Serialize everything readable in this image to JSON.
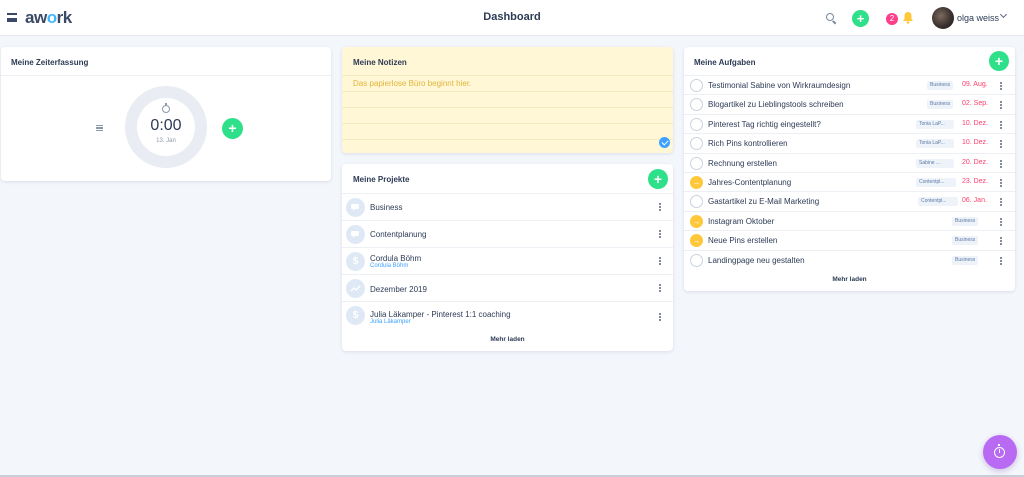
{
  "header": {
    "logo_prefix": "aw",
    "logo_o": "o",
    "logo_suffix": "rk",
    "title": "Dashboard",
    "add_label": "+",
    "notification_count": "2",
    "user_name": "olga weiss"
  },
  "time_tracking": {
    "title": "Meine Zeiterfassung",
    "time": "0:00",
    "date": "13. Jan",
    "add_label": "+"
  },
  "notes": {
    "title": "Meine Notizen",
    "text": "Das papierlose Büro beginnt hier."
  },
  "projects": {
    "title": "Meine Projekte",
    "add_label": "+",
    "items": [
      {
        "name": "Business",
        "sub": "",
        "icon": "chat-icon"
      },
      {
        "name": "Contentplanung",
        "sub": "",
        "icon": "chat-icon"
      },
      {
        "name": "Cordula Böhm",
        "sub": "Cordula Böhm",
        "icon": "dollar-icon"
      },
      {
        "name": "Dezember 2019",
        "sub": "",
        "icon": "trend-icon"
      },
      {
        "name": "Julia Läkamper - Pinterest 1:1 coaching",
        "sub": "Julia Läkamper",
        "icon": "dollar-icon"
      }
    ],
    "more_label": "Mehr laden"
  },
  "tasks": {
    "title": "Meine Aufgaben",
    "add_label": "+",
    "items": [
      {
        "name": "Testimonial Sabine von Wirkraumdesign",
        "tag": "Business",
        "date": "09. Aug.",
        "status": "open"
      },
      {
        "name": "Blogartikel zu Lieblingstools schreiben",
        "tag": "Business",
        "date": "02. Sep.",
        "status": "open"
      },
      {
        "name": "Pinterest Tag richtig eingestellt?",
        "tag": "Tonia LaP...",
        "date": "10. Dez.",
        "status": "open"
      },
      {
        "name": "Rich Pins kontrollieren",
        "tag": "Tonia LaP...",
        "date": "10. Dez.",
        "status": "open"
      },
      {
        "name": "Rechnung erstellen",
        "tag": "Sabine ...",
        "date": "20. Dez.",
        "status": "open"
      },
      {
        "name": "Jahres-Contentplanung",
        "tag": "Contentpl...",
        "date": "23. Dez.",
        "status": "in-progress"
      },
      {
        "name": "Gastartikel zu E-Mail Marketing",
        "tag": "Contentpl...",
        "date": "06. Jan.",
        "status": "open"
      },
      {
        "name": "Instagram Oktober",
        "tag": "Business",
        "date": "",
        "status": "in-progress"
      },
      {
        "name": "Neue Pins erstellen",
        "tag": "Business",
        "date": "",
        "status": "in-progress"
      },
      {
        "name": "Landingpage neu gestalten",
        "tag": "Business",
        "date": "",
        "status": "open"
      }
    ],
    "more_label": "Mehr laden"
  },
  "colors": {
    "accent_green": "#2fe08a",
    "due_red": "#ff3e6c",
    "progress_yellow": "#ffc73a",
    "timer_purple": "#b86af2",
    "notes_bg": "#fff7d6"
  }
}
